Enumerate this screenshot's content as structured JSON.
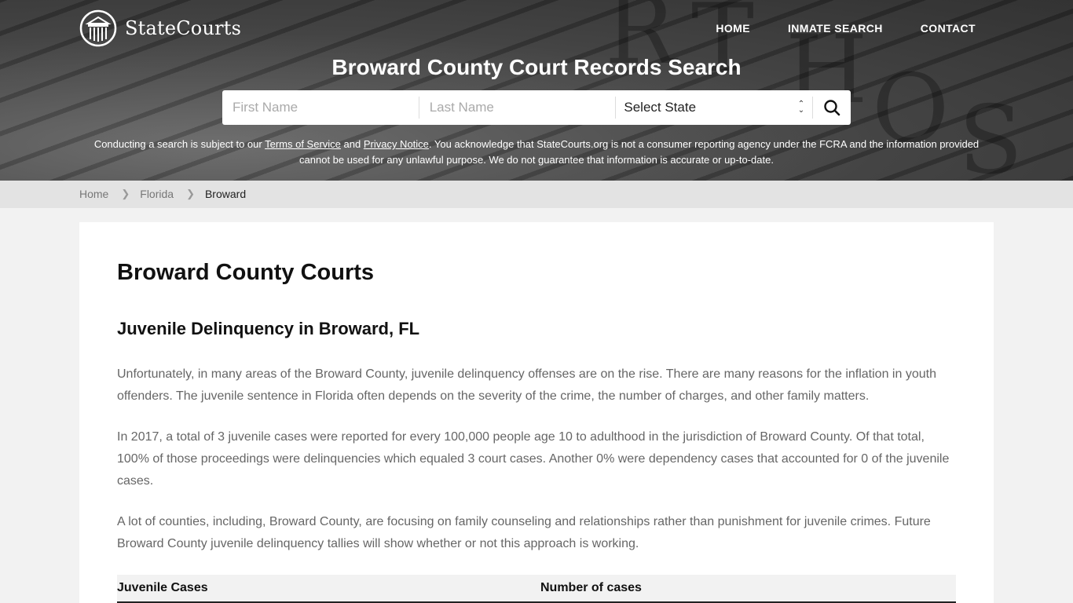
{
  "brand": {
    "name": "StateCourts"
  },
  "nav": {
    "items": [
      {
        "label": "HOME"
      },
      {
        "label": "INMATE SEARCH"
      },
      {
        "label": "CONTACT"
      }
    ]
  },
  "hero": {
    "title": "Broward County Court Records Search",
    "search": {
      "first_name_placeholder": "First Name",
      "last_name_placeholder": "Last Name",
      "state_selected": "Select State",
      "search_icon": "search-icon"
    },
    "disclaimer": {
      "pre": "Conducting a search is subject to our ",
      "terms_link": "Terms of Service",
      "and": " and ",
      "privacy_link": "Privacy Notice",
      "post": ". You acknowledge that StateCourts.org is not a consumer reporting agency under the FCRA and the information provided cannot be used for any unlawful purpose. We do not guarantee that information is accurate or up-to-date."
    }
  },
  "breadcrumb": {
    "items": [
      {
        "label": "Home"
      },
      {
        "label": "Florida"
      },
      {
        "label": "Broward"
      }
    ]
  },
  "main": {
    "title": "Broward County Courts",
    "section_title": "Juvenile Delinquency in Broward, FL",
    "paragraphs": [
      "Unfortunately, in many areas of the Broward County, juvenile delinquency offenses are on the rise. There are many reasons for the inflation in youth offenders. The juvenile sentence in Florida often depends on the severity of the crime, the number of charges, and other family matters.",
      "In 2017, a total of 3 juvenile cases were reported for every 100,000 people age 10 to adulthood in the jurisdiction of Broward County. Of that total, 100% of those proceedings were delinquencies which equaled 3 court cases. Another 0% were dependency cases that accounted for 0 of the juvenile cases.",
      "A lot of counties, including, Broward County, are focusing on family counseling and relationships rather than punishment for juvenile crimes. Future Broward County juvenile delinquency tallies will show whether or not this approach is working."
    ],
    "table": {
      "headers": [
        "Juvenile Cases",
        "Number of cases"
      ]
    }
  }
}
